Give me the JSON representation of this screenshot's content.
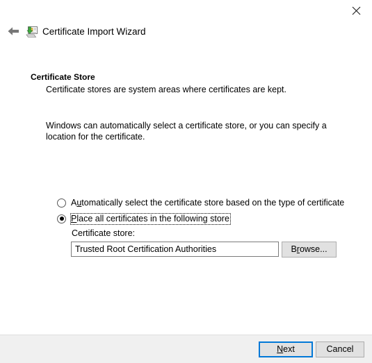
{
  "window": {
    "title": "Certificate Import Wizard",
    "icon": "certificate-wizard-icon",
    "close_label": "×",
    "back_label": "←"
  },
  "page": {
    "heading": "Certificate Store",
    "subheading": "Certificate stores are system areas where certificates are kept.",
    "intro": "Windows can automatically select a certificate store, or you can specify a location for the certificate."
  },
  "options": {
    "auto": {
      "label_pre": "A",
      "label_accel": "u",
      "label_post": "tomatically select the certificate store based on the type of certificate",
      "checked": false,
      "focused": false
    },
    "place": {
      "label_pre": "",
      "label_accel": "P",
      "label_post": "lace all certificates in the following store",
      "checked": true,
      "focused": true
    }
  },
  "store": {
    "label": "Certificate store:",
    "value": "Trusted Root Certification Authorities",
    "placeholder": "",
    "browse_pre": "B",
    "browse_accel": "r",
    "browse_post": "owse..."
  },
  "footer": {
    "next_pre": "",
    "next_accel": "N",
    "next_post": "ext",
    "cancel_label": "Cancel"
  },
  "colors": {
    "accent": "#0078d7",
    "button_face": "#e1e1e1",
    "button_border": "#adadad",
    "footer_bg": "#f0f0f0",
    "body_bg": "#ffffff",
    "text": "#000000",
    "back_arrow": "#767676"
  }
}
